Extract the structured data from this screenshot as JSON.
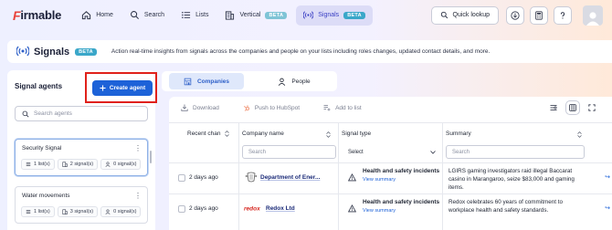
{
  "app": {
    "logo_text": "irmable",
    "logo_letter": "F"
  },
  "nav": {
    "items": [
      {
        "label": "Home",
        "icon": "home-icon"
      },
      {
        "label": "Search",
        "icon": "search-icon"
      },
      {
        "label": "Lists",
        "icon": "list-icon"
      },
      {
        "label": "Vertical",
        "icon": "building-icon",
        "badge": "BETA"
      },
      {
        "label": "Signals",
        "icon": "signal-icon",
        "badge": "BETA",
        "active": true
      }
    ],
    "quick_lookup": "Quick lookup",
    "right_icons": [
      "download-icon",
      "calculator-icon",
      "help-icon",
      "avatar"
    ]
  },
  "header": {
    "title": "Signals",
    "badge": "BETA",
    "description": "Action real-time insights from signals across the companies and people on your lists including roles changes, updated contact details, and more."
  },
  "sidebar": {
    "title": "Signal agents",
    "create_button": "Create agent",
    "search_placeholder": "Search agents",
    "agents": [
      {
        "name": "Security Signal",
        "lists": "1 list(s)",
        "signals": "2 signal(s)",
        "opportunities": "0 signal(s)",
        "selected": true
      },
      {
        "name": "Water movements",
        "lists": "1 list(s)",
        "signals": "3 signal(s)",
        "opportunities": "0 signal(s)",
        "selected": false
      }
    ]
  },
  "tabs": [
    {
      "label": "Companies",
      "active": true,
      "icon": "building-icon"
    },
    {
      "label": "People",
      "active": false,
      "icon": "person-icon"
    }
  ],
  "toolbar": {
    "download": "Download",
    "push_hubspot": "Push to HubSpot",
    "add_to_list": "Add to list",
    "right_icons": [
      "filter-columns-icon",
      "columns-icon",
      "expand-icon"
    ]
  },
  "table": {
    "columns": [
      {
        "label": "Recent chan",
        "sortable": true
      },
      {
        "label": "Company name",
        "sortable": true,
        "filter_placeholder": "Search"
      },
      {
        "label": "Signal type",
        "sortable": false,
        "filter_placeholder": "Select"
      },
      {
        "label": "Summary",
        "sortable": true,
        "filter_placeholder": "Search"
      }
    ],
    "rows": [
      {
        "date": "2 days ago",
        "company": "Department of Ener...",
        "logo": "government-crest",
        "signal_type": "Health and safety incidents",
        "view_link": "View summary",
        "summary": "LGIRS gaming investigators raid illegal Baccarat casino in Marangaroo, seize $83,000 and gaming items."
      },
      {
        "date": "2 days ago",
        "company": "Redox Ltd",
        "logo": "redox-logo",
        "signal_type": "Health and safety incidents",
        "view_link": "View summary",
        "summary": "Redox celebrates 60 years of commitment to workplace health and safety standards."
      }
    ]
  },
  "colors": {
    "accent": "#1d62d8",
    "beta_badge": "#3aa7c9",
    "highlight_border": "#e0211a",
    "active_tab": "#dfe8fb"
  }
}
